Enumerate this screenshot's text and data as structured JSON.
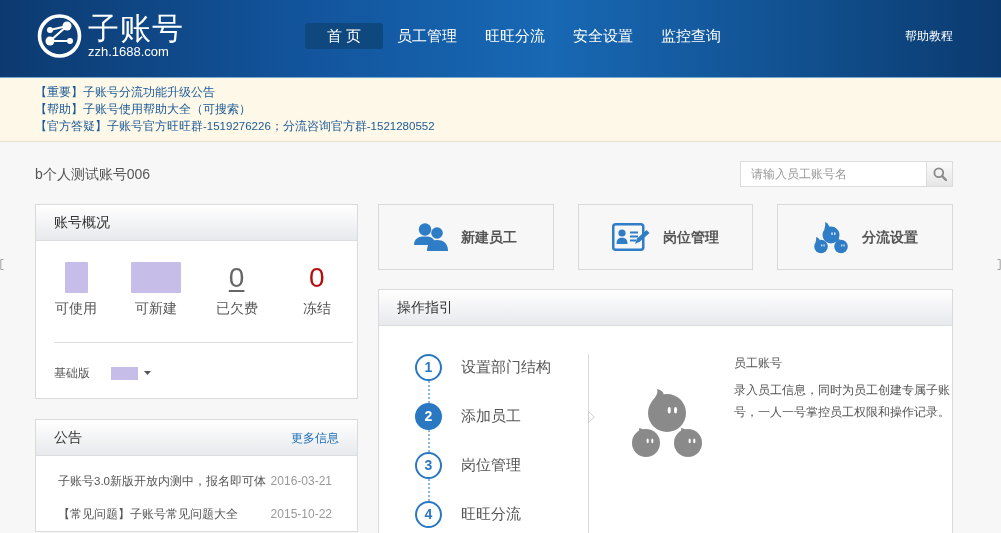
{
  "header": {
    "logo_title": "子账号",
    "logo_domain": "zzh.1688.com",
    "nav": [
      {
        "label": "首 页",
        "selected": true
      },
      {
        "label": "员工管理",
        "selected": false
      },
      {
        "label": "旺旺分流",
        "selected": false
      },
      {
        "label": "安全设置",
        "selected": false
      },
      {
        "label": "监控查询",
        "selected": false
      }
    ],
    "help_link": "帮助教程"
  },
  "notices": [
    "【重要】子账号分流功能升级公告",
    "【帮助】子账号使用帮助大全（可搜索）",
    "【官方答疑】子账号官方旺旺群-1519276226；分流咨询官方群-1521280552"
  ],
  "account_name": "b个人测试账号006",
  "search": {
    "placeholder": "请输入员工账号名"
  },
  "overview": {
    "title": "账号概况",
    "stats": [
      {
        "kind": "redacted",
        "label": "可使用"
      },
      {
        "kind": "redacted",
        "label": "可新建"
      },
      {
        "kind": "link",
        "value": "0",
        "label": "已欠费"
      },
      {
        "kind": "alert",
        "value": "0",
        "label": "冻结"
      }
    ],
    "edition_label": "基础版"
  },
  "announcements": {
    "title": "公告",
    "more_link": "更多信息",
    "items": [
      {
        "text": "子账号3.0新版开放内测中，报名即可体",
        "date": "2016-03-21"
      },
      {
        "text": "【常见问题】子账号常见问题大全",
        "date": "2015-10-22"
      }
    ]
  },
  "quick_actions": [
    {
      "kind": "people",
      "label": "新建员工"
    },
    {
      "kind": "id-card",
      "label": "岗位管理"
    },
    {
      "kind": "blobs",
      "label": "分流设置"
    }
  ],
  "guide": {
    "title": "操作指引",
    "steps": [
      {
        "number": "1",
        "label": "设置部门结构",
        "selected": false
      },
      {
        "number": "2",
        "label": "添加员工",
        "selected": true
      },
      {
        "number": "3",
        "label": "岗位管理",
        "selected": false
      },
      {
        "number": "4",
        "label": "旺旺分流",
        "selected": false
      }
    ],
    "detail": {
      "title": "员工账号",
      "text": "录入员工信息，同时为员工创建专属子账号，一人一号掌控员工权限和操作记录。"
    }
  }
}
